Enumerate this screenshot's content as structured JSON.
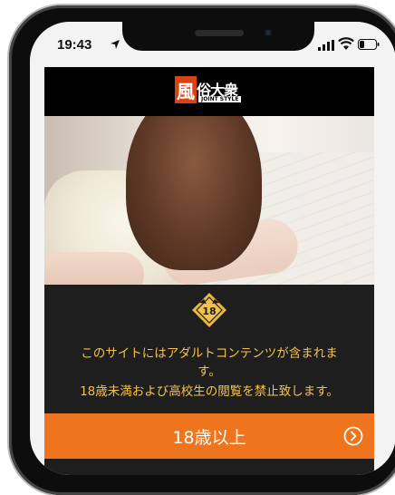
{
  "status_bar": {
    "time": "19:43",
    "location_icon": "location-arrow-icon",
    "signal_icon": "cellular-signal-icon",
    "wifi_icon": "wifi-icon",
    "battery_icon": "battery-icon"
  },
  "header": {
    "logo_mark": "風",
    "logo_text": "俗大衆",
    "logo_sub": "JOINT STYLE",
    "logo_color": "#d84315"
  },
  "age_gate": {
    "badge_text": "18",
    "warning_line1": "このサイトにはアダルトコンテンツが含まれま",
    "warning_line2": "す。",
    "warning_line3": "18歳未満および高校生の閲覧を禁止致します。",
    "text_color": "#f4c24a"
  },
  "enter_button": {
    "label": "18歳以上",
    "icon": "chevron-right-circle-icon",
    "color": "#ee741d"
  }
}
